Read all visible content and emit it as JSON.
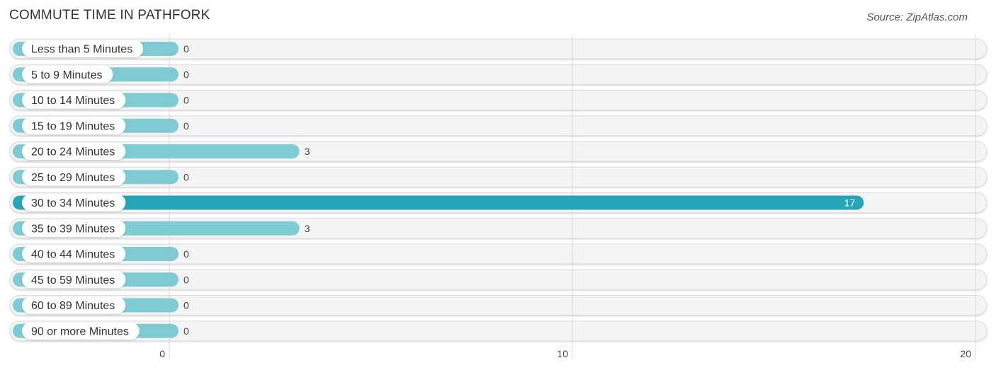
{
  "header": {
    "title": "COMMUTE TIME IN PATHFORK",
    "source": "Source: ZipAtlas.com"
  },
  "chart_data": {
    "type": "bar",
    "orientation": "horizontal",
    "title": "COMMUTE TIME IN PATHFORK",
    "xlabel": "",
    "ylabel": "",
    "categories": [
      "Less than 5 Minutes",
      "5 to 9 Minutes",
      "10 to 14 Minutes",
      "15 to 19 Minutes",
      "20 to 24 Minutes",
      "25 to 29 Minutes",
      "30 to 34 Minutes",
      "35 to 39 Minutes",
      "40 to 44 Minutes",
      "45 to 59 Minutes",
      "60 to 89 Minutes",
      "90 or more Minutes"
    ],
    "values": [
      0,
      0,
      0,
      0,
      3,
      0,
      17,
      3,
      0,
      0,
      0,
      0
    ],
    "xlim": [
      0,
      20
    ],
    "xticks": [
      0,
      10,
      20
    ],
    "grid": true,
    "colors": {
      "bar": "#7ecbd4",
      "bar_highlight": "#27a5b8",
      "row_background": "#f4f4f4"
    },
    "highlight_index": 6
  }
}
